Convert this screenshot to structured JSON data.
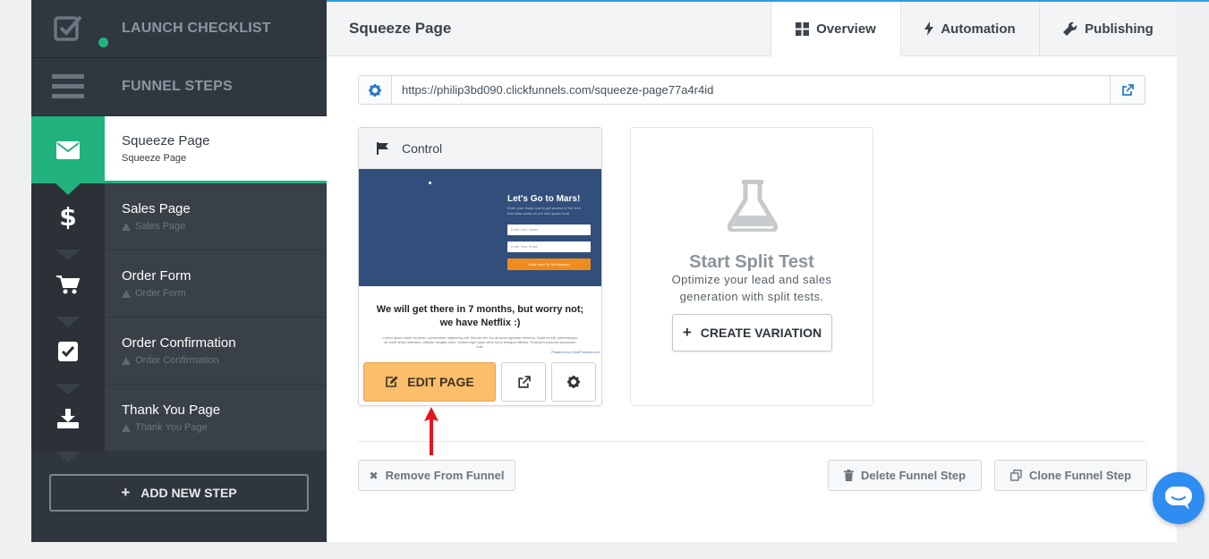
{
  "sidebar": {
    "launch_checklist": "LAUNCH CHECKLIST",
    "funnel_steps": "FUNNEL STEPS",
    "steps": [
      {
        "title": "Squeeze Page",
        "subtitle": "Squeeze Page"
      },
      {
        "title": "Sales Page",
        "subtitle": "Sales Page"
      },
      {
        "title": "Order Form",
        "subtitle": "Order Form"
      },
      {
        "title": "Order Confirmation",
        "subtitle": "Order Confirmation"
      },
      {
        "title": "Thank You Page",
        "subtitle": "Thank You Page"
      }
    ],
    "add_new_step": "ADD NEW STEP"
  },
  "header": {
    "title": "Squeeze Page",
    "tabs": [
      "Overview",
      "Automation",
      "Publishing"
    ]
  },
  "url_bar": {
    "value": "https://philip3bd090.clickfunnels.com/squeeze-page77a4r4id"
  },
  "control_card": {
    "label": "Control",
    "preview": {
      "heading": "Let's Go to Mars!",
      "sub1": "Enter your email now to get access to the tech",
      "sub2": "first class seats on our new space craft",
      "field_name": "Enter Your Name",
      "field_email": "Enter Your Email",
      "cta": "Click Here To Get Access!",
      "headline": "We will get there in 7 months, but worry not; we have Netflix :)",
      "lorem": "Lorem ipsum dolor sit amet, consectetur adipiscing elit. Mauris nec leo at lacus egestas vehicula. Nulla mi elit, pellentesque sit amet tellus interdum, efficitur fringilla dolor. Nullam eget justo vitae nunc tristique efficitur. Praesent posuere accumsan odio.",
      "powered": "Powered by ClickFunnels.com"
    },
    "edit_label": "EDIT PAGE"
  },
  "split_test": {
    "title": "Start Split Test",
    "description": "Optimize your lead and sales generation with split tests.",
    "button": "CREATE VARIATION"
  },
  "footer": {
    "remove": "Remove From Funnel",
    "delete": "Delete Funnel Step",
    "clone": "Clone Funnel Step"
  },
  "colors": {
    "accent_green": "#21b27e",
    "edit_orange": "#fbbe6a",
    "link_blue": "#2e9ee6",
    "arrow_red": "#e8141b"
  }
}
